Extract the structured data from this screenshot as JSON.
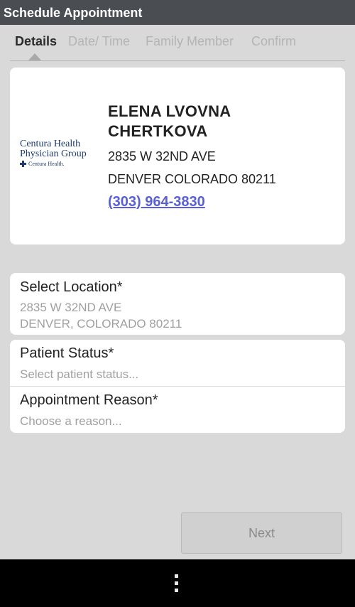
{
  "app": {
    "title": "Schedule Appointment"
  },
  "tabs": [
    {
      "label": "Details",
      "active": true
    },
    {
      "label": "Date/ Time",
      "active": false
    },
    {
      "label": "Family Member",
      "active": false
    },
    {
      "label": "Confirm",
      "active": false
    }
  ],
  "provider": {
    "logo_line1": "Centura Health",
    "logo_line2": "Physician Group",
    "logo_small": "Centura Health.",
    "name_line1": "ELENA LVOVNA",
    "name_line2": "CHERTKOVA",
    "address1": "2835 W 32ND AVE",
    "address2": "DENVER COLORADO 80211",
    "phone": "(303) 964-3830"
  },
  "form": {
    "location": {
      "label": "Select Location*",
      "value_line1": "2835 W 32ND AVE",
      "value_line2": "DENVER, COLORADO 80211"
    },
    "patient_status": {
      "label": "Patient Status*",
      "placeholder": "Select patient status..."
    },
    "appointment_reason": {
      "label": "Appointment Reason*",
      "placeholder": "Choose a reason..."
    }
  },
  "actions": {
    "next_label": "Next"
  },
  "navbar": {
    "menu_icon": "overflow-menu-icon"
  },
  "colors": {
    "titlebar": "#4a4d52",
    "link": "#5a5fd6",
    "background": "#d9d9d9"
  }
}
